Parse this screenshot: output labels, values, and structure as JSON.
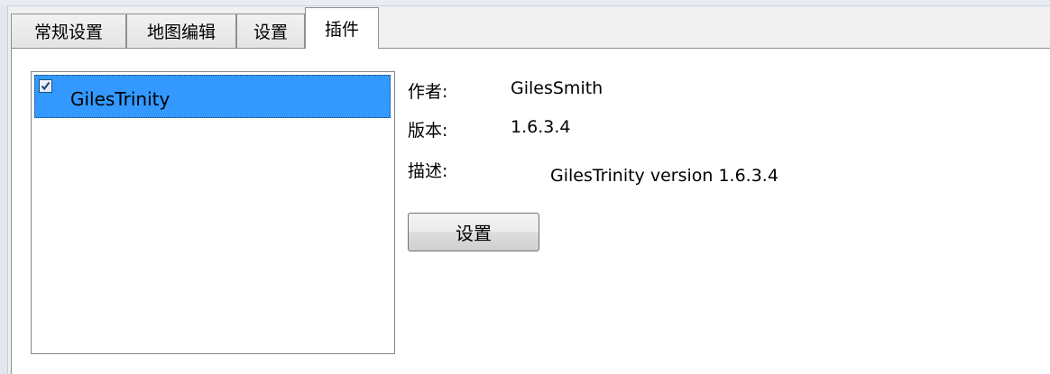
{
  "tabs": [
    {
      "label": "常规设置"
    },
    {
      "label": "地图编辑"
    },
    {
      "label": "设置"
    },
    {
      "label": "插件"
    }
  ],
  "active_tab": "插件",
  "plugin_list": {
    "items": [
      {
        "label": "GilesTrinity",
        "checked": true,
        "selected": true
      }
    ]
  },
  "details": {
    "author_label": "作者:",
    "author_value": "GilesSmith",
    "version_label": "版本:",
    "version_value": "1.6.3.4",
    "description_label": "描述:",
    "description_value": "GilesTrinity version 1.6.3.4"
  },
  "settings_button": {
    "label": "设置"
  },
  "colors": {
    "selection": "#3399ff",
    "panel_background": "#ffffff",
    "window_background": "#f0f0f0",
    "border": "#8e8f8f"
  }
}
